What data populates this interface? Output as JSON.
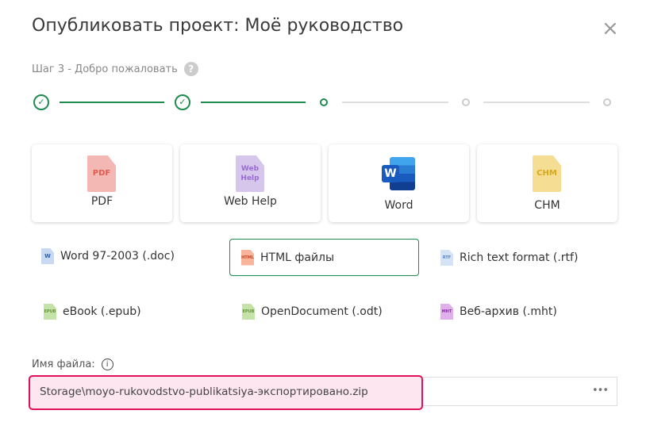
{
  "dialog": {
    "title": "Опубликовать проект: Моё руководство",
    "close_icon": "×"
  },
  "stepper": {
    "label": "Шаг 3 - Добро пожаловать",
    "help": "?",
    "current_step": 3,
    "total_steps": 5,
    "accent": "#1e8c4e"
  },
  "cards": [
    {
      "label": "PDF",
      "icon_text": "PDF",
      "color": "#f4b8b4",
      "text_color": "#e05a4f"
    },
    {
      "label": "Web Help",
      "icon_text": "Web Help",
      "color": "#d6c6ec",
      "text_color": "#9a6bd2"
    },
    {
      "label": "Word",
      "icon_text": "W"
    },
    {
      "label": "CHM",
      "icon_text": "CHM",
      "color": "#f5de94",
      "text_color": "#d9a71a"
    }
  ],
  "options": [
    {
      "label": "Word 97-2003 (.doc)",
      "icon_text": "W"
    },
    {
      "label": "HTML файлы",
      "icon_text": "HTML",
      "selected": true
    },
    {
      "label": "Rich text format (.rtf)",
      "icon_text": "RTF"
    },
    {
      "label": "eBook (.epub)",
      "icon_text": "EPUB"
    },
    {
      "label": "OpenDocument (.odt)",
      "icon_text": "EPUB"
    },
    {
      "label": "Веб-архив (.mht)",
      "icon_text": "MHT"
    }
  ],
  "filename": {
    "label": "Имя файла:",
    "info": "i",
    "value": "Storage\\moyo-rukovodstvo-publikatsiya-экспортировано.zip",
    "browse": "•••"
  }
}
